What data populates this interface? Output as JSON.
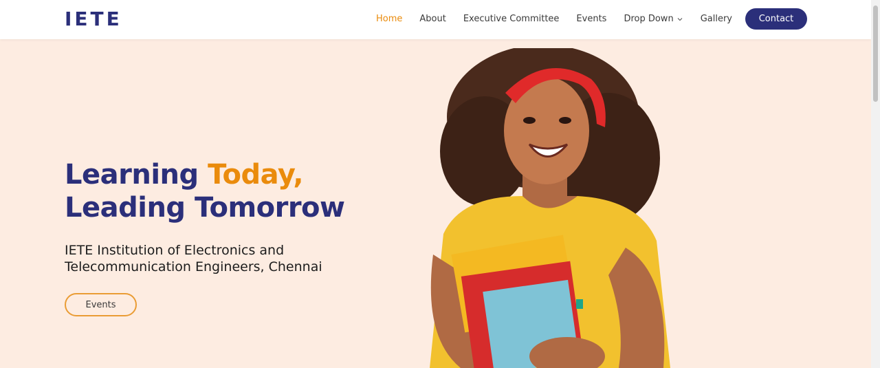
{
  "brand": {
    "logo_text": "IETE"
  },
  "nav": {
    "items": [
      {
        "label": "Home",
        "active": true
      },
      {
        "label": "About"
      },
      {
        "label": "Executive Committee"
      },
      {
        "label": "Events"
      },
      {
        "label": "Drop Down",
        "icon": "chevron-down-icon"
      },
      {
        "label": "Gallery"
      }
    ],
    "contact_label": "Contact"
  },
  "hero": {
    "title_line1_part1": "Learning ",
    "title_line1_accent": "Today,",
    "title_line2": "Leading Tomorrow",
    "subtitle": "IETE Institution of Electronics and Telecommunication Engineers, Chennai",
    "cta_label": "Events"
  },
  "colors": {
    "brand": "#2b2f7a",
    "accent": "#ea8b0c",
    "background": "#fdece1"
  }
}
